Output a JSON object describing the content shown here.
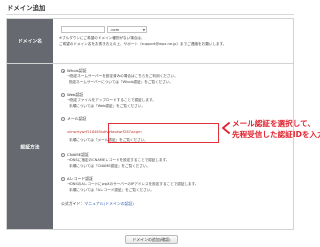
{
  "page": {
    "heading": "ドメイン追加"
  },
  "domain_row": {
    "label": "ドメイン名",
    "name_value": "",
    "tld_value": ".com",
    "help_1": "※プルダウンにご希望のドメイン種別がない場合は、",
    "help_2": "ご希望のドメイン名をお書きおえの上、サポート（support@wpx.ne.jp）までご連絡をお願いします。"
  },
  "method_row": {
    "label": "認証方法",
    "options": [
      {
        "label": "Whois認証",
        "selected": true
      },
      {
        "label": "Web認証",
        "selected": false
      },
      {
        "label": "メール認証",
        "selected": false
      },
      {
        "label": "CNAME認証",
        "selected": false
      },
      {
        "label": "Aレコード認証",
        "selected": false
      }
    ],
    "whois_desc_1": "→指定ネームサーバーを設定済みの場合はこちらをご利用ください。",
    "whois_desc_2": "指定ネームサーバーについては『Whois認証』をご覧ください。",
    "web_desc_1": "→指定ファイルをアップロードすることで認証します。",
    "web_desc_2": "手順については『Web認証』をご覧ください。",
    "mail_auth_id": "ukhwrtywrf218485sdfvefasdwrf287wcgm",
    "mail_desc": "手順については『メール認証』をご覧ください。",
    "cname_desc_1": "→DNSに指定のCNAMEレコードを設定することで認証します。",
    "cname_desc_2": "手順については『CNAME認証』をご覧ください。",
    "arec_desc_1": "→DNSのAレコードにwpXのサーバーのIPアドレスを設定することで認証します。",
    "arec_desc_2": "手順については『Aレコード認証』をご覧ください。",
    "manual_prefix": "公式ガイド：",
    "manual_link": "マニュアル(ドメインの認証)"
  },
  "annotation": {
    "line_1": "メール認証を選択して、",
    "line_2": "先程受信した認証IDを入力。"
  },
  "submit_label": "ドメインの追加(確認)",
  "colors": {
    "label_bg": "#666a70",
    "accent_red": "#e02430",
    "radio_blue": "#2b6cc4"
  }
}
